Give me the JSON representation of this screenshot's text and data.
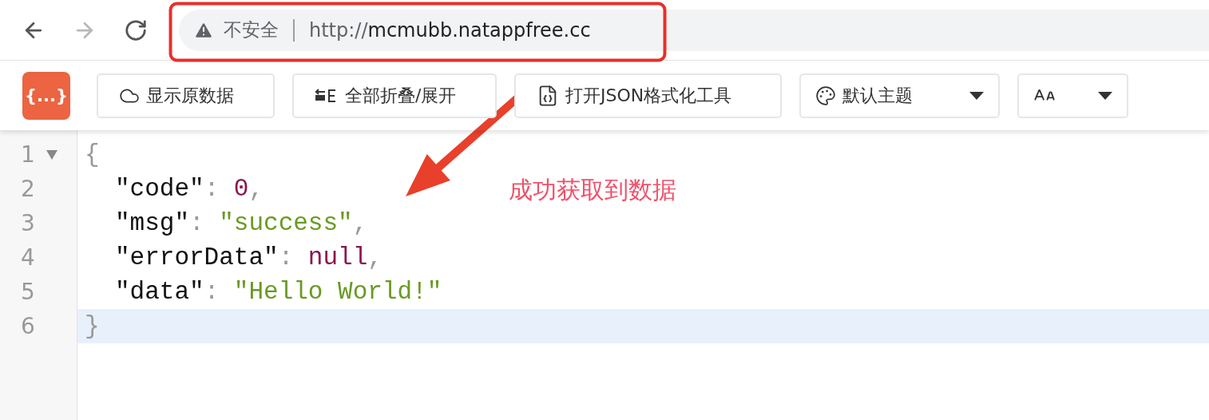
{
  "browser": {
    "nav": [
      {
        "kind": "back",
        "disabled": false
      },
      {
        "kind": "forward",
        "disabled": true
      },
      {
        "kind": "reload",
        "disabled": false
      }
    ],
    "security_label": "不安全",
    "url_scheme": "http://",
    "url_host": "mcmubb.natappfree.cc"
  },
  "toolbar": {
    "logo": "{...}",
    "items": [
      {
        "kind": "raw",
        "label": "显示原数据"
      },
      {
        "kind": "fold",
        "label": "全部折叠/展开"
      },
      {
        "kind": "json-tool",
        "label": "打开JSON格式化工具"
      },
      {
        "kind": "theme",
        "label": "默认主题"
      },
      {
        "kind": "font"
      }
    ]
  },
  "editor": {
    "lines": [
      {
        "number": "1",
        "foldable": true,
        "selected": false,
        "tokens": [
          {
            "kind": "punct",
            "text": "{"
          }
        ]
      },
      {
        "number": "2",
        "foldable": false,
        "selected": false,
        "tokens": [
          {
            "kind": "key",
            "text": "\"code\""
          },
          {
            "kind": "punct",
            "text": ":"
          },
          {
            "kind": "number",
            "text": "0"
          },
          {
            "kind": "punct",
            "text": ","
          }
        ]
      },
      {
        "number": "3",
        "foldable": false,
        "selected": false,
        "tokens": [
          {
            "kind": "key",
            "text": "\"msg\""
          },
          {
            "kind": "punct",
            "text": ":"
          },
          {
            "kind": "string",
            "text": "\"success\""
          },
          {
            "kind": "punct",
            "text": ","
          }
        ]
      },
      {
        "number": "4",
        "foldable": false,
        "selected": false,
        "tokens": [
          {
            "kind": "key",
            "text": "\"errorData\""
          },
          {
            "kind": "punct",
            "text": ":"
          },
          {
            "kind": "null",
            "text": "null"
          },
          {
            "kind": "punct",
            "text": ","
          }
        ]
      },
      {
        "number": "5",
        "foldable": false,
        "selected": false,
        "tokens": [
          {
            "kind": "key",
            "text": "\"data\""
          },
          {
            "kind": "punct",
            "text": ":"
          },
          {
            "kind": "string",
            "text": "\"Hello World!\""
          }
        ]
      },
      {
        "number": "6",
        "foldable": false,
        "selected": true,
        "tokens": [
          {
            "kind": "punct",
            "text": "}"
          }
        ]
      }
    ]
  },
  "annotation": {
    "text": "成功获取到数据"
  }
}
